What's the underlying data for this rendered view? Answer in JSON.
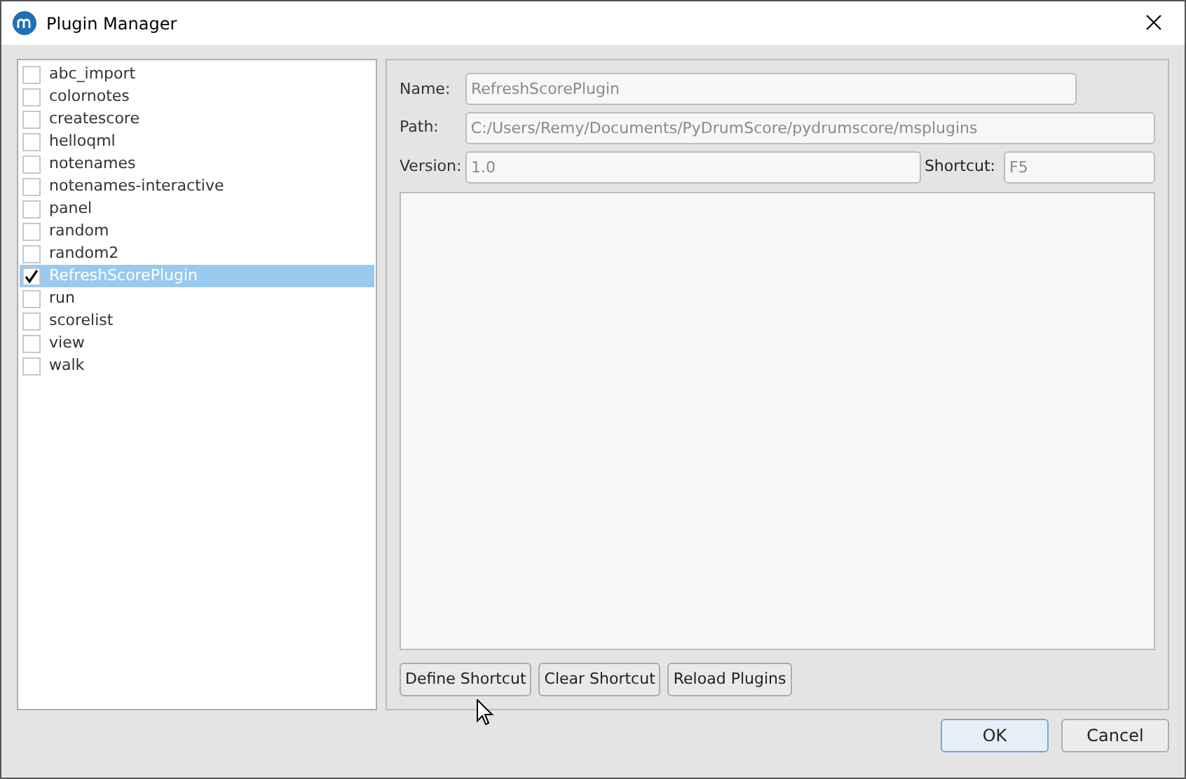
{
  "window": {
    "title": "Plugin Manager"
  },
  "plugins": [
    {
      "label": "abc_import",
      "checked": false,
      "selected": false
    },
    {
      "label": "colornotes",
      "checked": false,
      "selected": false
    },
    {
      "label": "createscore",
      "checked": false,
      "selected": false
    },
    {
      "label": "helloqml",
      "checked": false,
      "selected": false
    },
    {
      "label": "notenames",
      "checked": false,
      "selected": false
    },
    {
      "label": "notenames-interactive",
      "checked": false,
      "selected": false
    },
    {
      "label": "panel",
      "checked": false,
      "selected": false
    },
    {
      "label": "random",
      "checked": false,
      "selected": false
    },
    {
      "label": "random2",
      "checked": false,
      "selected": false
    },
    {
      "label": "RefreshScorePlugin",
      "checked": true,
      "selected": true
    },
    {
      "label": "run",
      "checked": false,
      "selected": false
    },
    {
      "label": "scorelist",
      "checked": false,
      "selected": false
    },
    {
      "label": "view",
      "checked": false,
      "selected": false
    },
    {
      "label": "walk",
      "checked": false,
      "selected": false
    }
  ],
  "details": {
    "name": {
      "label": "Name:",
      "value": "RefreshScorePlugin"
    },
    "path": {
      "label": "Path:",
      "value": "C:/Users/Remy/Documents/PyDrumScore/pydrumscore/msplugins"
    },
    "version": {
      "label": "Version:",
      "value": "1.0"
    },
    "shortcut": {
      "label": "Shortcut:",
      "value": "F5"
    }
  },
  "actions": [
    "Define Shortcut",
    "Clear Shortcut",
    "Reload Plugins"
  ],
  "dialog_buttons": [
    {
      "label": "OK",
      "default": true
    },
    {
      "label": "Cancel",
      "default": false
    }
  ]
}
